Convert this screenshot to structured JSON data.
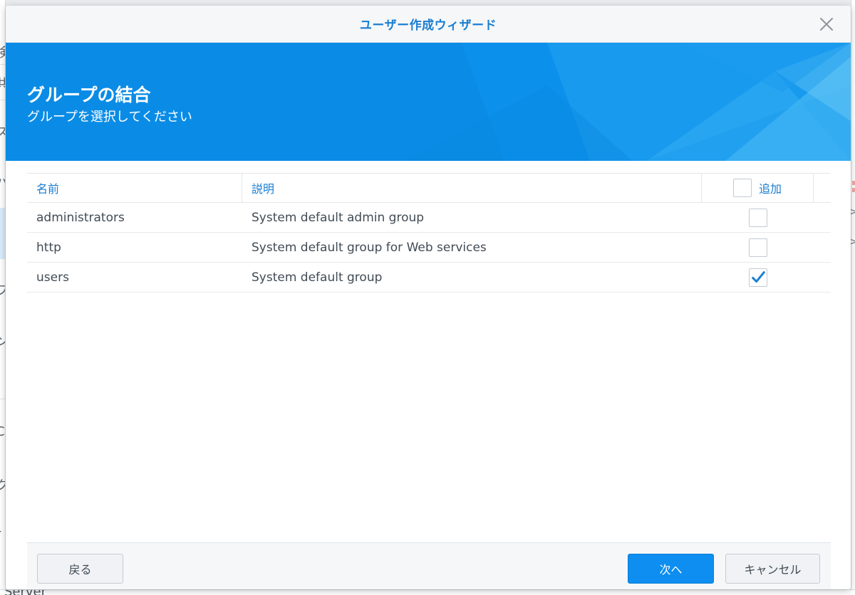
{
  "background": {
    "left_fragments": [
      "検",
      "共",
      "ス",
      "ハ",
      "フ",
      "ン",
      "C",
      "ク",
      "r"
    ],
    "bottom_fragment": "Server",
    "right_fragment": ">"
  },
  "dialog": {
    "title": "ユーザー作成ウィザード",
    "close_icon": "close-icon",
    "banner": {
      "heading": "グループの結合",
      "subheading": "グループを選択してください"
    },
    "grid": {
      "columns": {
        "name": "名前",
        "description": "説明",
        "add": "追加"
      },
      "header_checked": false,
      "rows": [
        {
          "name": "administrators",
          "description": "System default admin group",
          "checked": false
        },
        {
          "name": "http",
          "description": "System default group for Web services",
          "checked": false
        },
        {
          "name": "users",
          "description": "System default group",
          "checked": true
        }
      ]
    },
    "footer": {
      "back_label": "戻る",
      "next_label": "次へ",
      "cancel_label": "キャンセル"
    }
  },
  "colors": {
    "accent": "#1a7ed1",
    "banner": "#0a8ce6",
    "primary_button": "#0d8ef0"
  }
}
